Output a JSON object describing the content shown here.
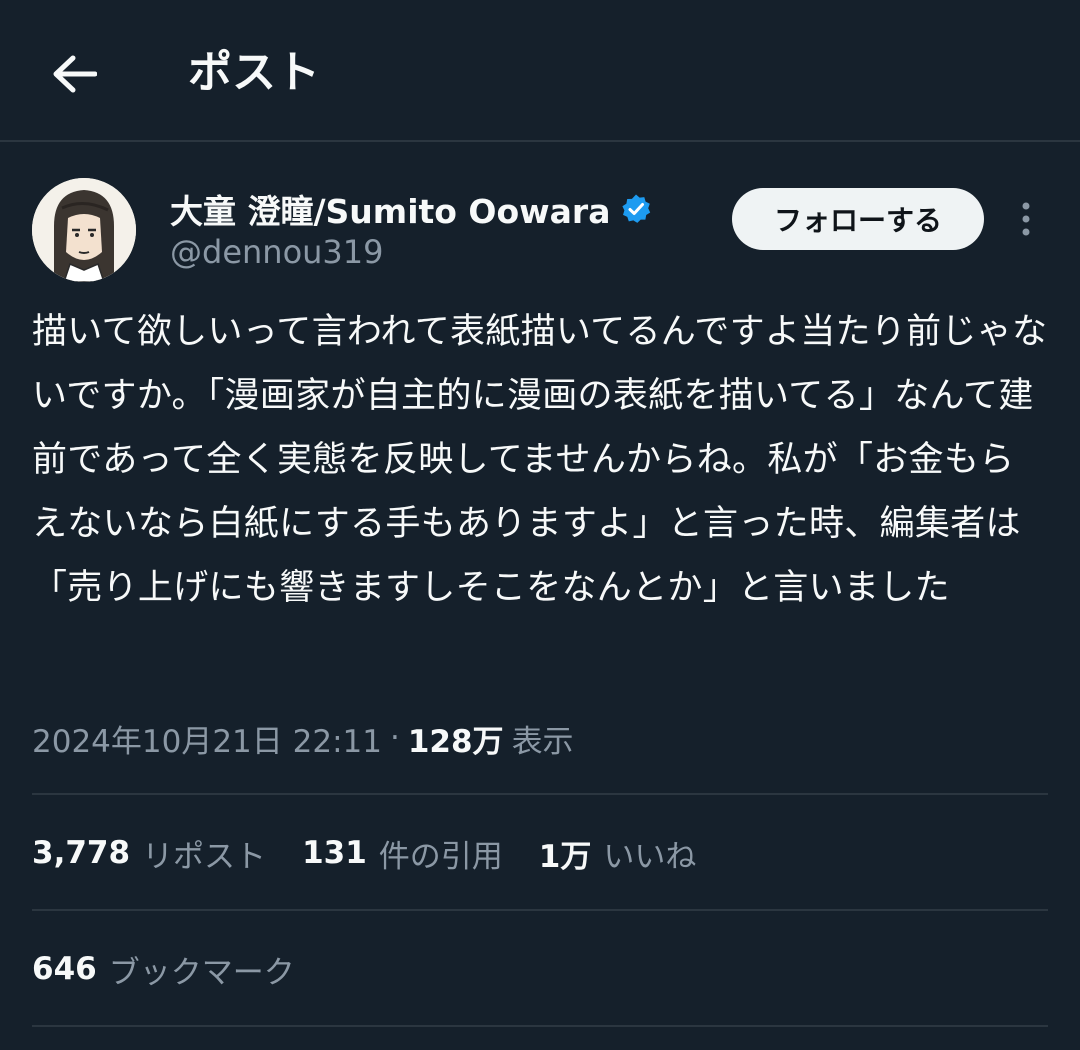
{
  "header": {
    "title": "ポスト",
    "back_icon": "arrow-left-icon"
  },
  "author": {
    "display_name": "大童 澄瞳/Sumito Oowara",
    "handle": "@dennou319",
    "verified_icon": "verified-badge-icon",
    "verified_color": "#1d9bf0"
  },
  "follow_button": {
    "label": "フォローする"
  },
  "more_icon": "more-vertical-icon",
  "tweet": {
    "text": "描いて欲しいって言われて表紙描いてるんですよ当たり前じゃないですか。「漫画家が自主的に漫画の表紙を描いてる」なんて建前であって全く実態を反映してませんからね。私が「お金もらえないなら白紙にする手もありますよ」と言った時、編集者は「売り上げにも響きますしそこをなんとか」と言いました"
  },
  "meta": {
    "timestamp": "2024年10月21日 22:11",
    "separator": "·",
    "views_count": "128万",
    "views_label": "表示"
  },
  "stats": {
    "reposts_count": "3,778",
    "reposts_label": "リポスト",
    "quotes_count": "131",
    "quotes_label": "件の引用",
    "likes_count": "1万",
    "likes_label": "いいね",
    "bookmarks_count": "646",
    "bookmarks_label": "ブックマーク"
  },
  "colors": {
    "background": "#15202b",
    "text_primary": "#f7f9f9",
    "text_secondary": "#8b98a5",
    "divider": "#2b3640",
    "follow_button_bg": "#eff3f4"
  }
}
